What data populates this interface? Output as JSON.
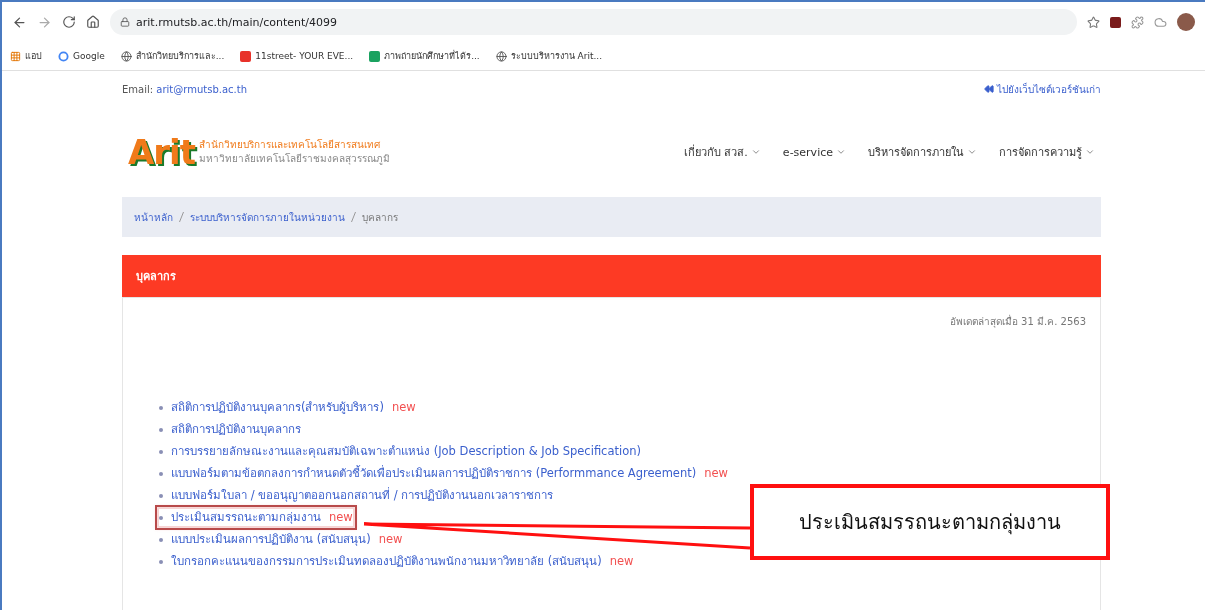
{
  "browser": {
    "url": "arit.rmutsb.ac.th/main/content/4099",
    "bookmarks": [
      {
        "kind": "apps",
        "label": "แอป"
      },
      {
        "kind": "google",
        "label": "Google"
      },
      {
        "kind": "globe",
        "label": "สำนักวิทยบริการและ..."
      },
      {
        "kind": "red",
        "label": "11street- YOUR EVE..."
      },
      {
        "kind": "green",
        "label": "ภาพถ่ายนักศึกษาที่ได้ร..."
      },
      {
        "kind": "globe",
        "label": "ระบบบริหารงาน Arit..."
      }
    ]
  },
  "topbar": {
    "email_label": "Email:",
    "email": "arit@rmutsb.ac.th",
    "old_site": "ไปยังเว็บไซต์เวอร์ชันเก่า"
  },
  "header": {
    "logo_text": "Arit",
    "org_name": "สำนักวิทยบริการและเทคโนโลยีสารสนเทศ",
    "university": "มหาวิทยาลัยเทคโนโลยีราชมงคลสุวรรณภูมิ",
    "nav": [
      "เกี่ยวกับ สวส.",
      "e-service",
      "บริหารจัดการภายใน",
      "การจัดการความรู้"
    ]
  },
  "breadcrumb": [
    {
      "label": "หน้าหลัก",
      "link": true
    },
    {
      "label": "ระบบบริหารจัดการภายในหน่วยงาน",
      "link": true
    },
    {
      "label": "บุคลากร",
      "link": false
    }
  ],
  "panel": {
    "title": "บุคลากร",
    "updated": "อัพเดตล่าสุดเมื่อ 31 มี.ค. 2563",
    "items": [
      {
        "text": "สถิติการปฏิบัติงานบุคลากร(สำหรับผู้บริหาร)",
        "badge": "new",
        "highlighted": false
      },
      {
        "text": "สถิติการปฏิบัติงานบุคลากร",
        "highlighted": false
      },
      {
        "text": "การบรรยายลักษณะงานและคุณสมบัติเฉพาะตำแหน่ง (Job Description & Job Specification)",
        "highlighted": false
      },
      {
        "text": "แบบฟอร์มตามข้อตกลงการกำหนดตัวชี้วัดเพื่อประเมินผลการปฏิบัติราชการ (Performmance Agreement)",
        "badge": "new",
        "highlighted": false
      },
      {
        "text": "แบบฟอร์มใบลา / ขออนุญาตออกนอกสถานที่ / การปฏิบัติงานนอกเวลาราชการ",
        "highlighted": false
      },
      {
        "text": "ประเมินสมรรถนะตามกลุ่มงาน",
        "badge": "new",
        "highlighted": true
      },
      {
        "text": "แบบประเมินผลการปฏิบัติงาน (สนับสนุน)",
        "badge": "new",
        "highlighted": false
      },
      {
        "text": "ใบกรอกคะแนนของกรรมการประเมินทดลองปฏิบัติงานพนักงานมหาวิทยาลัย (สนับสนุน)",
        "badge": "new",
        "highlighted": false
      }
    ]
  },
  "callout": {
    "text": "ประเมินสมรรถนะตามกลุ่มงาน"
  }
}
